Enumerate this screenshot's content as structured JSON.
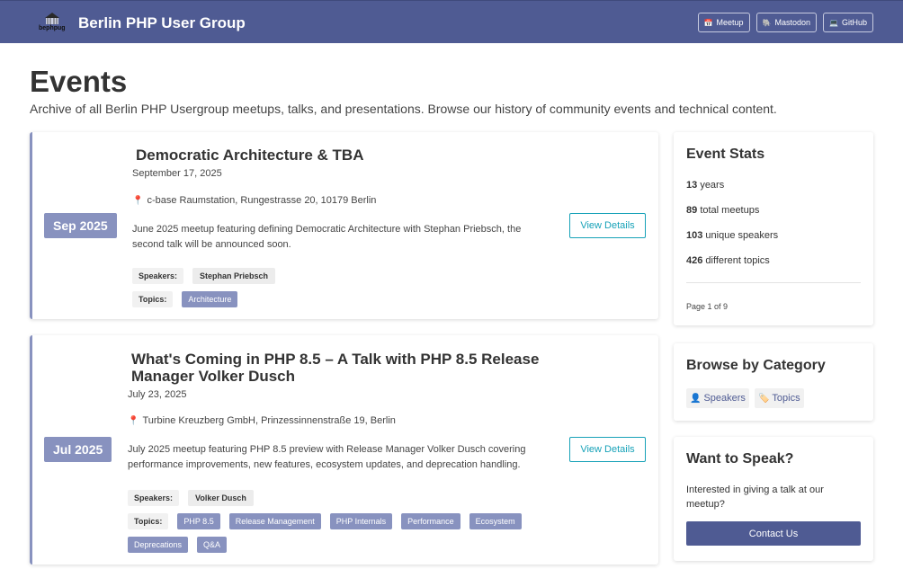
{
  "header": {
    "brand": "Berlin PHP User Group",
    "logo_text": "bephpug",
    "nav": [
      {
        "label": "Meetup",
        "icon": "calendar-icon"
      },
      {
        "label": "Mastodon",
        "icon": "mastodon-icon"
      },
      {
        "label": "GitHub",
        "icon": "computer-icon"
      }
    ]
  },
  "hero": {
    "title": "Events",
    "description": "Archive of all Berlin PHP Usergroup meetups, talks, and presentations. Browse our history of community events and technical content."
  },
  "events": [
    {
      "badge": "Sep 2025",
      "title": "Democratic Architecture & TBA",
      "date": "September 17, 2025",
      "location": "c-base Raumstation, Rungestrasse 20, 10179 Berlin",
      "description": "June 2025 meetup featuring defining Democratic Architecture with Stephan Priebsch, the second talk will be announced soon.",
      "speakers_label": "Speakers:",
      "speakers": [
        "Stephan Priebsch"
      ],
      "topics_label": "Topics:",
      "topics": [
        "Architecture"
      ],
      "button": "View Details"
    },
    {
      "badge": "Jul 2025",
      "title": "What's Coming in PHP 8.5 – A Talk with PHP 8.5 Release Manager Volker Dusch",
      "date": "July 23, 2025",
      "location": "Turbine Kreuzberg GmbH, Prinzessinnenstraße 19, Berlin",
      "description": "July 2025 meetup featuring PHP 8.5 preview with Release Manager Volker Dusch covering performance improvements, new features, ecosystem updates, and deprecation handling.",
      "speakers_label": "Speakers:",
      "speakers": [
        "Volker Dusch"
      ],
      "topics_label": "Topics:",
      "topics": [
        "PHP 8.5",
        "Release Management",
        "PHP Internals",
        "Performance",
        "Ecosystem",
        "Deprecations",
        "Q&A"
      ],
      "button": "View Details"
    }
  ],
  "stats": {
    "title": "Event Stats",
    "items": [
      {
        "value": "13",
        "label": "years"
      },
      {
        "value": "89",
        "label": "total meetups"
      },
      {
        "value": "103",
        "label": "unique speakers"
      },
      {
        "value": "426",
        "label": "different topics"
      }
    ],
    "page_info": "Page 1 of 9"
  },
  "categories": {
    "title": "Browse by Category",
    "links": [
      {
        "label": "Speakers",
        "icon": "person-icon"
      },
      {
        "label": "Topics",
        "icon": "tag-icon"
      }
    ]
  },
  "speak": {
    "title": "Want to Speak?",
    "text": "Interested in giving a talk at our meetup?",
    "button": "Contact Us"
  },
  "colors": {
    "header_bg": "#4f5b93",
    "accent": "#8892bf",
    "button_teal": "#17a2b8"
  }
}
